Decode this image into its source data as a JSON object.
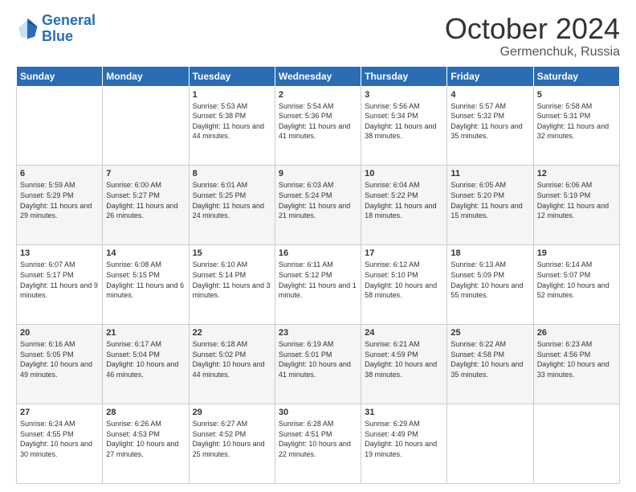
{
  "logo": {
    "line1": "General",
    "line2": "Blue"
  },
  "header": {
    "month": "October 2024",
    "location": "Germenchuk, Russia"
  },
  "weekdays": [
    "Sunday",
    "Monday",
    "Tuesday",
    "Wednesday",
    "Thursday",
    "Friday",
    "Saturday"
  ],
  "weeks": [
    [
      {
        "day": "",
        "info": ""
      },
      {
        "day": "",
        "info": ""
      },
      {
        "day": "1",
        "info": "Sunrise: 5:53 AM\nSunset: 5:38 PM\nDaylight: 11 hours and 44 minutes."
      },
      {
        "day": "2",
        "info": "Sunrise: 5:54 AM\nSunset: 5:36 PM\nDaylight: 11 hours and 41 minutes."
      },
      {
        "day": "3",
        "info": "Sunrise: 5:56 AM\nSunset: 5:34 PM\nDaylight: 11 hours and 38 minutes."
      },
      {
        "day": "4",
        "info": "Sunrise: 5:57 AM\nSunset: 5:32 PM\nDaylight: 11 hours and 35 minutes."
      },
      {
        "day": "5",
        "info": "Sunrise: 5:58 AM\nSunset: 5:31 PM\nDaylight: 11 hours and 32 minutes."
      }
    ],
    [
      {
        "day": "6",
        "info": "Sunrise: 5:59 AM\nSunset: 5:29 PM\nDaylight: 11 hours and 29 minutes."
      },
      {
        "day": "7",
        "info": "Sunrise: 6:00 AM\nSunset: 5:27 PM\nDaylight: 11 hours and 26 minutes."
      },
      {
        "day": "8",
        "info": "Sunrise: 6:01 AM\nSunset: 5:25 PM\nDaylight: 11 hours and 24 minutes."
      },
      {
        "day": "9",
        "info": "Sunrise: 6:03 AM\nSunset: 5:24 PM\nDaylight: 11 hours and 21 minutes."
      },
      {
        "day": "10",
        "info": "Sunrise: 6:04 AM\nSunset: 5:22 PM\nDaylight: 11 hours and 18 minutes."
      },
      {
        "day": "11",
        "info": "Sunrise: 6:05 AM\nSunset: 5:20 PM\nDaylight: 11 hours and 15 minutes."
      },
      {
        "day": "12",
        "info": "Sunrise: 6:06 AM\nSunset: 5:19 PM\nDaylight: 11 hours and 12 minutes."
      }
    ],
    [
      {
        "day": "13",
        "info": "Sunrise: 6:07 AM\nSunset: 5:17 PM\nDaylight: 11 hours and 9 minutes."
      },
      {
        "day": "14",
        "info": "Sunrise: 6:08 AM\nSunset: 5:15 PM\nDaylight: 11 hours and 6 minutes."
      },
      {
        "day": "15",
        "info": "Sunrise: 6:10 AM\nSunset: 5:14 PM\nDaylight: 11 hours and 3 minutes."
      },
      {
        "day": "16",
        "info": "Sunrise: 6:11 AM\nSunset: 5:12 PM\nDaylight: 11 hours and 1 minute."
      },
      {
        "day": "17",
        "info": "Sunrise: 6:12 AM\nSunset: 5:10 PM\nDaylight: 10 hours and 58 minutes."
      },
      {
        "day": "18",
        "info": "Sunrise: 6:13 AM\nSunset: 5:09 PM\nDaylight: 10 hours and 55 minutes."
      },
      {
        "day": "19",
        "info": "Sunrise: 6:14 AM\nSunset: 5:07 PM\nDaylight: 10 hours and 52 minutes."
      }
    ],
    [
      {
        "day": "20",
        "info": "Sunrise: 6:16 AM\nSunset: 5:05 PM\nDaylight: 10 hours and 49 minutes."
      },
      {
        "day": "21",
        "info": "Sunrise: 6:17 AM\nSunset: 5:04 PM\nDaylight: 10 hours and 46 minutes."
      },
      {
        "day": "22",
        "info": "Sunrise: 6:18 AM\nSunset: 5:02 PM\nDaylight: 10 hours and 44 minutes."
      },
      {
        "day": "23",
        "info": "Sunrise: 6:19 AM\nSunset: 5:01 PM\nDaylight: 10 hours and 41 minutes."
      },
      {
        "day": "24",
        "info": "Sunrise: 6:21 AM\nSunset: 4:59 PM\nDaylight: 10 hours and 38 minutes."
      },
      {
        "day": "25",
        "info": "Sunrise: 6:22 AM\nSunset: 4:58 PM\nDaylight: 10 hours and 35 minutes."
      },
      {
        "day": "26",
        "info": "Sunrise: 6:23 AM\nSunset: 4:56 PM\nDaylight: 10 hours and 33 minutes."
      }
    ],
    [
      {
        "day": "27",
        "info": "Sunrise: 6:24 AM\nSunset: 4:55 PM\nDaylight: 10 hours and 30 minutes."
      },
      {
        "day": "28",
        "info": "Sunrise: 6:26 AM\nSunset: 4:53 PM\nDaylight: 10 hours and 27 minutes."
      },
      {
        "day": "29",
        "info": "Sunrise: 6:27 AM\nSunset: 4:52 PM\nDaylight: 10 hours and 25 minutes."
      },
      {
        "day": "30",
        "info": "Sunrise: 6:28 AM\nSunset: 4:51 PM\nDaylight: 10 hours and 22 minutes."
      },
      {
        "day": "31",
        "info": "Sunrise: 6:29 AM\nSunset: 4:49 PM\nDaylight: 10 hours and 19 minutes."
      },
      {
        "day": "",
        "info": ""
      },
      {
        "day": "",
        "info": ""
      }
    ]
  ]
}
